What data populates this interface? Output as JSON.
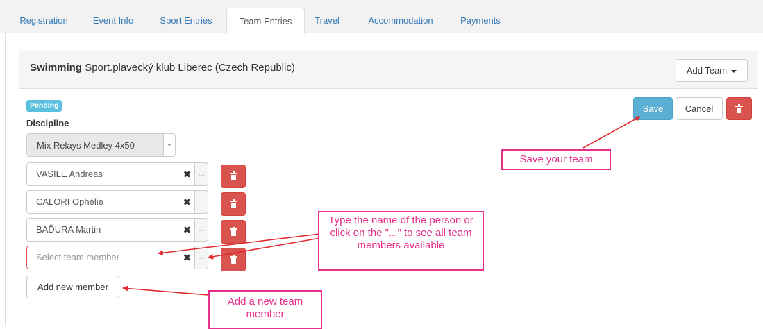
{
  "tabs": [
    {
      "label": "Registration",
      "active": false
    },
    {
      "label": "Event Info",
      "active": false
    },
    {
      "label": "Sport Entries",
      "active": false
    },
    {
      "label": "Team Entries",
      "active": true
    },
    {
      "label": "Travel",
      "active": false
    },
    {
      "label": "Accommodation",
      "active": false
    },
    {
      "label": "Payments",
      "active": false
    }
  ],
  "panel": {
    "sport": "Swimming",
    "club": "Sport.plavecký klub Liberec (Czech Republic)",
    "add_team_label": "Add Team"
  },
  "team": {
    "status": "Pending",
    "discipline_label": "Discipline",
    "discipline_value": "Mix Relays Medley 4x50",
    "members": [
      {
        "name": "VASILE Andreas"
      },
      {
        "name": "CALORI Ophélie"
      },
      {
        "name": "BAĎURA Martin"
      }
    ],
    "new_member_placeholder": "Select team member",
    "more_label": "...",
    "add_member_label": "Add new member"
  },
  "actions": {
    "save_label": "Save",
    "cancel_label": "Cancel"
  },
  "callouts": {
    "save": "Save your team",
    "type_name": "Type the name of the person or click on the \"...\" to see all team members available",
    "add_member": "Add a new team member"
  },
  "colors": {
    "link": "#337ab7",
    "primary": "#5bafd3",
    "danger": "#d9534f",
    "pending": "#5bc0de",
    "annotation": "#e62e8a",
    "arrow": "#e0282e"
  }
}
